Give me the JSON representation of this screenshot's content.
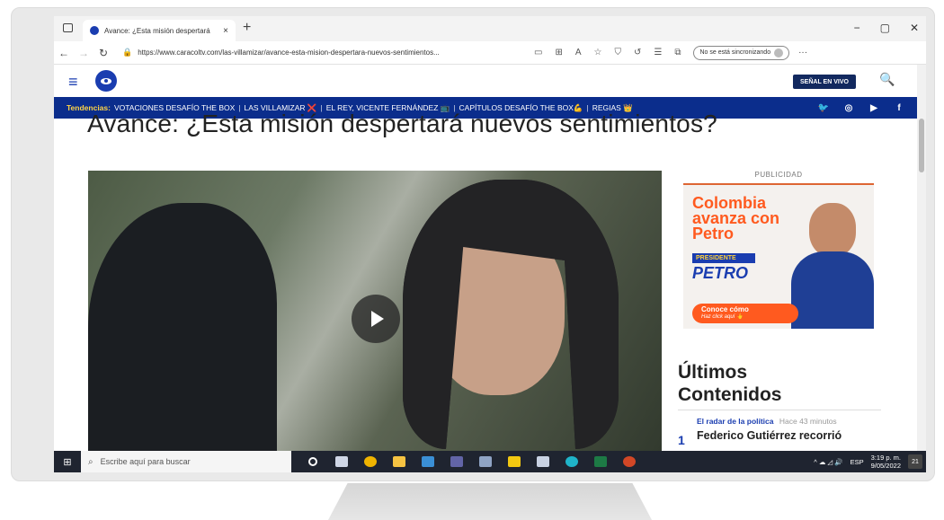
{
  "browser": {
    "tab_title": "Avance: ¿Esta misión despertará",
    "tab_close": "×",
    "new_tab": "+",
    "url": "https://www.caracoltv.com/las-villamizar/avance-esta-mision-despertara-nuevos-sentimientos...",
    "sync_label": "No se está sincronizando",
    "window_controls": [
      "−",
      "▢",
      "✕"
    ]
  },
  "site": {
    "live_button": "SEÑAL EN VIVO",
    "trends_label": "Tendencias:",
    "trends": [
      "VOTACIONES DESAFÍO THE BOX",
      "LAS VILLAMIZAR ❌",
      "EL REY, VICENTE FERNÁNDEZ 📺",
      "CAPÍTULOS DESAFÍO THE BOX💪",
      "REGIAS 👑"
    ],
    "social": [
      "twitter-icon",
      "instagram-icon",
      "youtube-icon",
      "facebook-icon"
    ]
  },
  "article": {
    "headline": "Avance: ¿Esta misión despertará nuevos sentimientos?"
  },
  "sidebar": {
    "ad_label": "PUBLICIDAD",
    "ad": {
      "headline": "Colombia avanza con Petro",
      "president": "PRESIDENTE",
      "name": "PETRO",
      "cta": "Conoce cómo",
      "cta_sub": "Haz click aquí 👆"
    },
    "latest": {
      "title": "Últimos Contenidos",
      "category": "El radar de la política",
      "time": "Hace 43 minutos",
      "number": "1",
      "item_title": "Federico Gutiérrez recorrió"
    }
  },
  "taskbar": {
    "search_placeholder": "Escribe aquí para buscar",
    "lang": "ESP",
    "time": "3:19 p. m.",
    "date": "9/05/2022",
    "notifications": "21"
  },
  "colors": {
    "brand_blue": "#1a3db0",
    "trend_bar": "#0b2d8c",
    "ad_orange": "#ff5a1f"
  }
}
